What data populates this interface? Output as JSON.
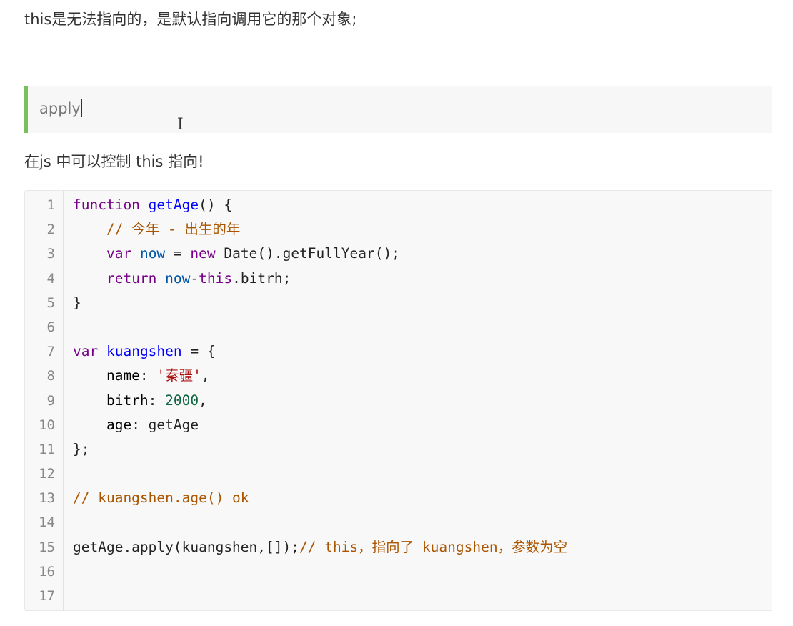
{
  "paragraph_top": "this是无法指向的，是默认指向调用它的那个对象;",
  "blockquote": {
    "text": "apply"
  },
  "paragraph_mid": "在js 中可以控制 this 指向!",
  "code": {
    "line_numbers": [
      "1",
      "2",
      "3",
      "4",
      "5",
      "6",
      "7",
      "8",
      "9",
      "10",
      "11",
      "12",
      "13",
      "14",
      "15",
      "16",
      "17"
    ],
    "line1": {
      "kw": "function",
      "def": "getAge",
      "rest": "() {"
    },
    "line2": {
      "comment": "    // 今年 - 出生的年"
    },
    "line3": {
      "indent": "    ",
      "kw": "var",
      "var": "now",
      "op": " = ",
      "kw2": "new",
      "rest": " Date().getFullYear();"
    },
    "line4": {
      "indent": "    ",
      "kw": "return",
      "var": "now",
      "op": "-",
      "kw2": "this",
      "rest": ".bitrh;"
    },
    "line5": "}",
    "line7": {
      "kw": "var",
      "def": "kuangshen",
      "rest": " = {"
    },
    "line8": {
      "prop": "    name",
      "sep": ": ",
      "str": "'秦疆'",
      "rest": ","
    },
    "line9": {
      "prop": "    bitrh",
      "sep": ": ",
      "num": "2000",
      "rest": ","
    },
    "line10": {
      "prop": "    age",
      "rest": ": getAge"
    },
    "line11": "};",
    "line13": {
      "comment": "// kuangshen.age() ok"
    },
    "line15": {
      "code": "getAge.apply(kuangshen,[]);",
      "comment": "// this，指向了 kuangshen，参数为空"
    }
  }
}
